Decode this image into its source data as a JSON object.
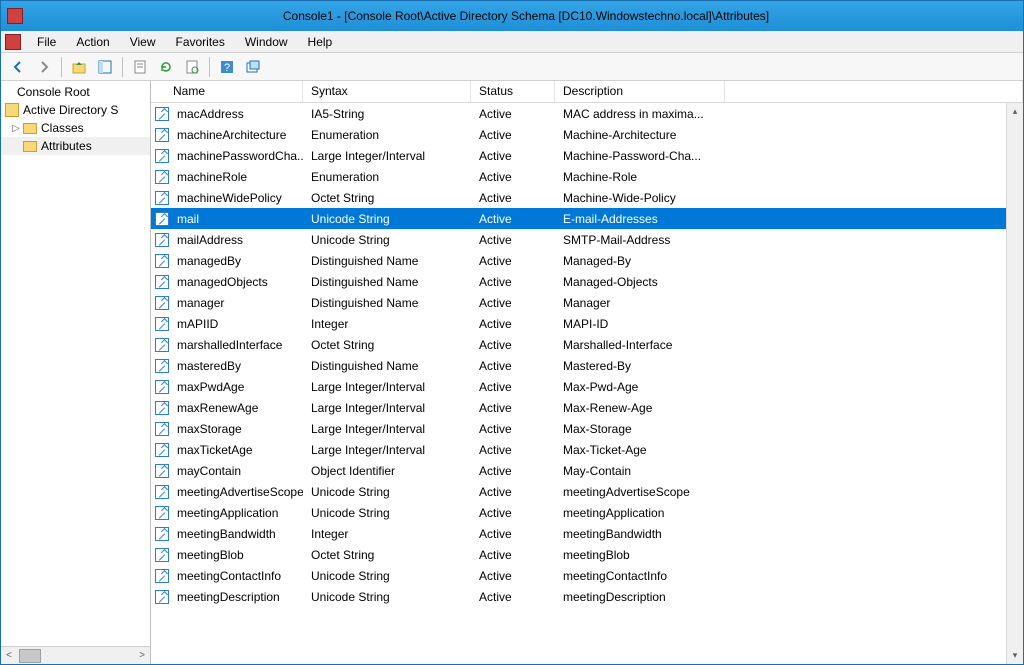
{
  "window": {
    "title": "Console1 - [Console Root\\Active Directory Schema [DC10.Windowstechno.local]\\Attributes]"
  },
  "menu": {
    "file": "File",
    "action": "Action",
    "view": "View",
    "favorites": "Favorites",
    "window": "Window",
    "help": "Help"
  },
  "tree": {
    "root": "Console Root",
    "schema": "Active Directory S",
    "classes": "Classes",
    "attributes": "Attributes"
  },
  "columns": {
    "name": "Name",
    "syntax": "Syntax",
    "status": "Status",
    "description": "Description"
  },
  "rows": [
    {
      "name": "macAddress",
      "syntax": "IA5-String",
      "status": "Active",
      "description": "MAC address in maxima..."
    },
    {
      "name": "machineArchitecture",
      "syntax": "Enumeration",
      "status": "Active",
      "description": "Machine-Architecture"
    },
    {
      "name": "machinePasswordCha...",
      "syntax": "Large Integer/Interval",
      "status": "Active",
      "description": "Machine-Password-Cha..."
    },
    {
      "name": "machineRole",
      "syntax": "Enumeration",
      "status": "Active",
      "description": "Machine-Role"
    },
    {
      "name": "machineWidePolicy",
      "syntax": "Octet String",
      "status": "Active",
      "description": "Machine-Wide-Policy"
    },
    {
      "name": "mail",
      "syntax": "Unicode String",
      "status": "Active",
      "description": "E-mail-Addresses",
      "selected": true
    },
    {
      "name": "mailAddress",
      "syntax": "Unicode String",
      "status": "Active",
      "description": "SMTP-Mail-Address"
    },
    {
      "name": "managedBy",
      "syntax": "Distinguished Name",
      "status": "Active",
      "description": "Managed-By"
    },
    {
      "name": "managedObjects",
      "syntax": "Distinguished Name",
      "status": "Active",
      "description": "Managed-Objects"
    },
    {
      "name": "manager",
      "syntax": "Distinguished Name",
      "status": "Active",
      "description": "Manager"
    },
    {
      "name": "mAPIID",
      "syntax": "Integer",
      "status": "Active",
      "description": "MAPI-ID"
    },
    {
      "name": "marshalledInterface",
      "syntax": "Octet String",
      "status": "Active",
      "description": "Marshalled-Interface"
    },
    {
      "name": "masteredBy",
      "syntax": "Distinguished Name",
      "status": "Active",
      "description": "Mastered-By"
    },
    {
      "name": "maxPwdAge",
      "syntax": "Large Integer/Interval",
      "status": "Active",
      "description": "Max-Pwd-Age"
    },
    {
      "name": "maxRenewAge",
      "syntax": "Large Integer/Interval",
      "status": "Active",
      "description": "Max-Renew-Age"
    },
    {
      "name": "maxStorage",
      "syntax": "Large Integer/Interval",
      "status": "Active",
      "description": "Max-Storage"
    },
    {
      "name": "maxTicketAge",
      "syntax": "Large Integer/Interval",
      "status": "Active",
      "description": "Max-Ticket-Age"
    },
    {
      "name": "mayContain",
      "syntax": "Object Identifier",
      "status": "Active",
      "description": "May-Contain"
    },
    {
      "name": "meetingAdvertiseScope",
      "syntax": "Unicode String",
      "status": "Active",
      "description": "meetingAdvertiseScope"
    },
    {
      "name": "meetingApplication",
      "syntax": "Unicode String",
      "status": "Active",
      "description": "meetingApplication"
    },
    {
      "name": "meetingBandwidth",
      "syntax": "Integer",
      "status": "Active",
      "description": "meetingBandwidth"
    },
    {
      "name": "meetingBlob",
      "syntax": "Octet String",
      "status": "Active",
      "description": "meetingBlob"
    },
    {
      "name": "meetingContactInfo",
      "syntax": "Unicode String",
      "status": "Active",
      "description": "meetingContactInfo"
    },
    {
      "name": "meetingDescription",
      "syntax": "Unicode String",
      "status": "Active",
      "description": "meetingDescription"
    }
  ]
}
